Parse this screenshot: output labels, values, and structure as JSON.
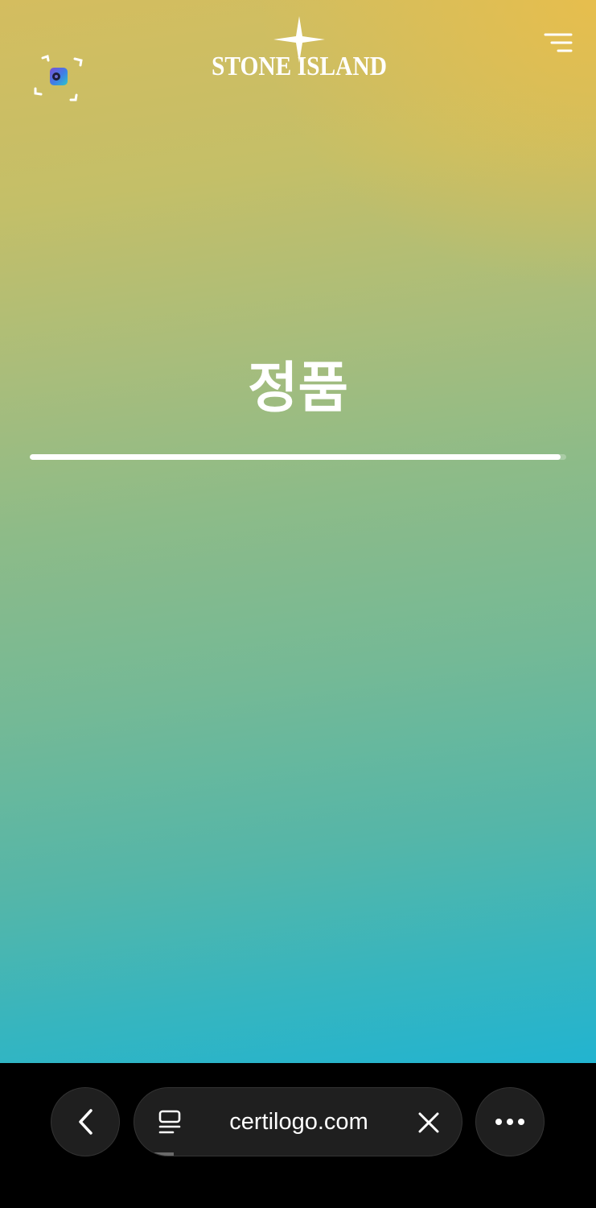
{
  "header": {
    "brand": "STONE ISLAND",
    "scan_icon": "scan-frame-icon",
    "menu_icon": "hamburger-menu-icon"
  },
  "main": {
    "verdict": "정품",
    "progress": 0.99
  },
  "browser": {
    "back_icon": "chevron-left-icon",
    "tabs_icon": "tabs-icon",
    "url": "certilogo.com",
    "close_icon": "close-icon",
    "more_icon": "more-dots-icon",
    "load_progress": 0.12
  },
  "colors": {
    "gradient_top": "#d4bd5f",
    "gradient_bottom": "#22b4d0",
    "accent_corner": "#efbe46",
    "text": "#ffffff",
    "toolbar": "#000000"
  }
}
